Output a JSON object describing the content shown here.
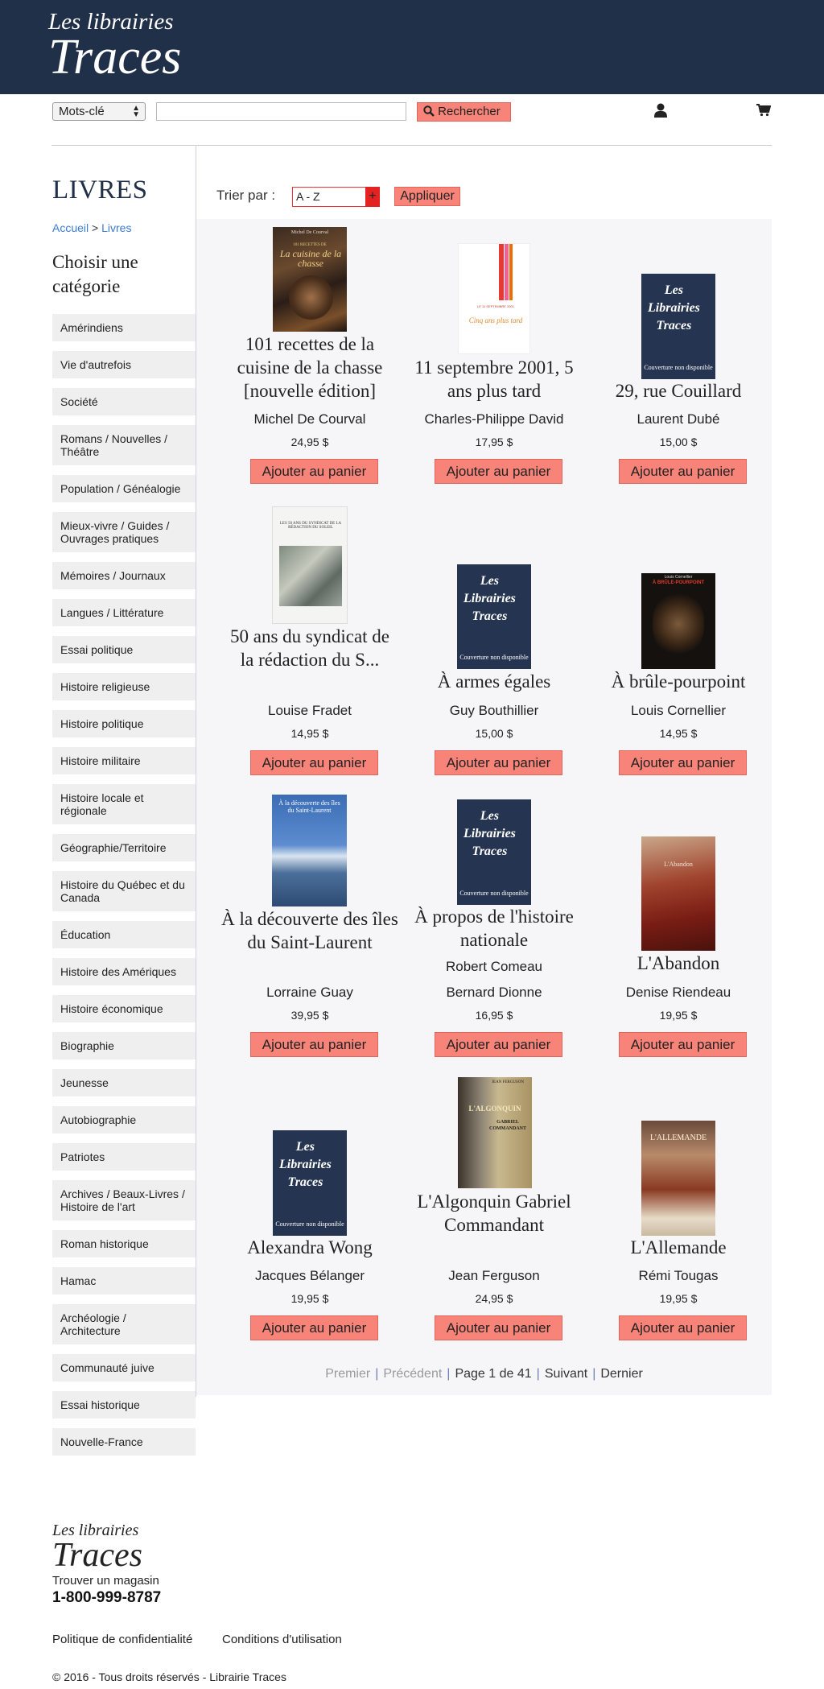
{
  "header": {
    "logo_line1": "Les librairies",
    "logo_line2": "Traces"
  },
  "search": {
    "select_value": "Mots-clé",
    "input_value": "",
    "button_label": "Rechercher"
  },
  "sidebar": {
    "title": "LIVRES",
    "breadcrumb": {
      "home": "Accueil",
      "sep": ">",
      "current": "Livres"
    },
    "choose_label": "Choisir une catégorie",
    "categories": [
      "Amérindiens",
      "Vie d'autrefois",
      "Société",
      "Romans / Nouvelles / Théâtre",
      "Population / Généalogie",
      "Mieux-vivre / Guides / Ouvrages pratiques",
      "Mémoires / Journaux",
      "Langues / Littérature",
      "Essai politique",
      "Histoire religieuse",
      "Histoire politique",
      "Histoire militaire",
      "Histoire locale et régionale",
      "Géographie/Territoire",
      "Histoire du Québec et du Canada",
      "Éducation",
      "Histoire des Amériques",
      "Histoire économique",
      "Biographie",
      "Jeunesse",
      "Autobiographie",
      "Patriotes",
      "Archives / Beaux-Livres / Histoire de l'art",
      "Roman historique",
      "Hamac",
      "Archéologie / Architecture",
      "Communauté juive",
      "Essai historique",
      "Nouvelle-France"
    ]
  },
  "sort": {
    "label": "Trier par :",
    "value": "A - Z",
    "apply_label": "Appliquer"
  },
  "add_label": "Ajouter au panier",
  "nocover": {
    "line1": "Les",
    "line2": "Librairies",
    "line3": "Traces",
    "sub": "Couverture non disponible"
  },
  "cover_texts": {
    "p0_a": "Michel De Courval",
    "p0_b": "101 RECETTES DE",
    "p0_c": "La cuisine de la chasse",
    "p1_a": "LE 11 SEPTEMBRE 2001",
    "p1_b": "Cinq ans plus tard",
    "p3_a": "LES 50 ANS DU SYNDICAT DE LA RÉDACTION DU SOLEIL",
    "p5_a": "Louis Cornellier",
    "p5_b": "À BRÛLE-POURPOINT",
    "p6_a": "À la découverte des îles du Saint-Laurent",
    "p8_a": "L'Abandon",
    "p10_a": "JEAN FERGUSON",
    "p10_b": "L'ALGONQUIN",
    "p10_c": "GABRIEL COMMANDANT",
    "p11_a": "L'ALLEMANDE"
  },
  "products": [
    {
      "title": "101 recettes de la cuisine de la chasse [nouvelle édition]",
      "authors": [
        "Michel De Courval"
      ],
      "price": "24,95 $"
    },
    {
      "title": "11 septembre 2001, 5 ans plus tard",
      "authors": [
        "Charles-Philippe David"
      ],
      "price": "17,95 $"
    },
    {
      "title": "29, rue Couillard",
      "authors": [
        "Laurent Dubé"
      ],
      "price": "15,00 $"
    },
    {
      "title": "50 ans du syndicat de la rédaction du S...",
      "authors": [
        "Louise Fradet"
      ],
      "price": "14,95 $"
    },
    {
      "title": "À armes égales",
      "authors": [
        "Guy Bouthillier"
      ],
      "price": "15,00 $"
    },
    {
      "title": "À brûle-pourpoint",
      "authors": [
        "Louis Cornellier"
      ],
      "price": "14,95 $"
    },
    {
      "title": "À la découverte des îles du Saint-Laurent",
      "authors": [
        "Lorraine Guay"
      ],
      "price": "39,95 $"
    },
    {
      "title": "À propos de l'histoire nationale",
      "authors": [
        "Robert Comeau",
        "Bernard Dionne"
      ],
      "price": "16,95 $"
    },
    {
      "title": "L'Abandon",
      "authors": [
        "Denise Riendeau"
      ],
      "price": "19,95 $"
    },
    {
      "title": "Alexandra Wong",
      "authors": [
        "Jacques Bélanger"
      ],
      "price": "19,95 $"
    },
    {
      "title": "L'Algonquin Gabriel Commandant",
      "authors": [
        "Jean Ferguson"
      ],
      "price": "24,95 $"
    },
    {
      "title": "L'Allemande",
      "authors": [
        "Rémi Tougas"
      ],
      "price": "19,95 $"
    }
  ],
  "pagination": {
    "first": "Premier",
    "prev": "Précédent",
    "page": "Page 1 de 41",
    "next": "Suivant",
    "last": "Dernier"
  },
  "footer": {
    "logo_line1": "Les librairies",
    "logo_line2": "Traces",
    "find_store": "Trouver un magasin",
    "phone": "1-800-999-8787",
    "privacy": "Politique de confidentialité",
    "terms": "Conditions d'utilisation",
    "copyright": "© 2016 - Tous droits réservés - Librairie Traces"
  },
  "colors": {
    "header_bg": "#213049",
    "button": "#f88379",
    "link": "#3a7bd5"
  }
}
